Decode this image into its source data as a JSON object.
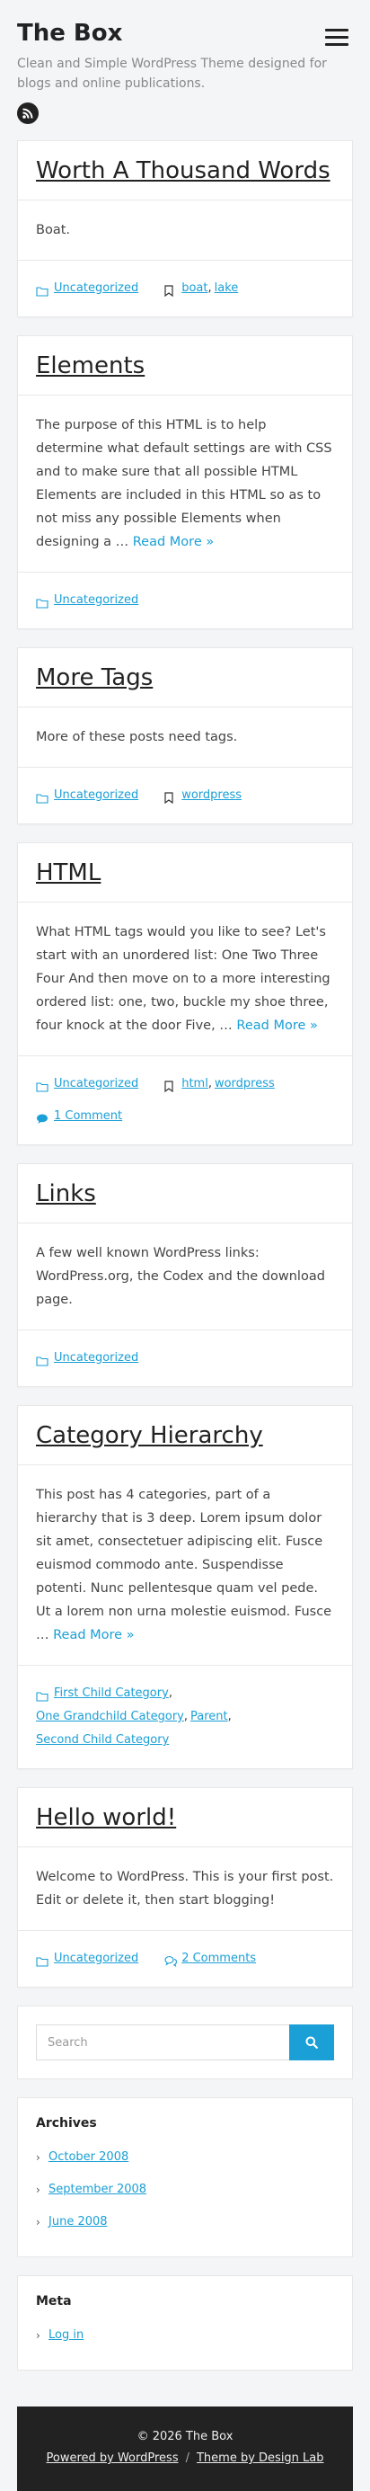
{
  "site": {
    "title": "The Box",
    "description": "Clean and Simple WordPress Theme designed for blogs and online publications."
  },
  "posts": [
    {
      "title": "Worth A Thousand Words",
      "excerpt": "Boat.",
      "more": "",
      "categories": [
        "Uncategorized"
      ],
      "tags": [
        "boat",
        "lake"
      ],
      "comments": ""
    },
    {
      "title": "Elements",
      "excerpt": "The purpose of this HTML is to help determine what default settings are with CSS and to make sure that all possible HTML Elements are included in this HTML so as to not miss any possible Elements when designing a …",
      "more": "Read More »",
      "categories": [
        "Uncategorized"
      ],
      "tags": [],
      "comments": ""
    },
    {
      "title": "More Tags",
      "excerpt": "More of these posts need tags.",
      "more": "",
      "categories": [
        "Uncategorized"
      ],
      "tags": [
        "wordpress"
      ],
      "comments": ""
    },
    {
      "title": "HTML",
      "excerpt": "What HTML tags would you like to see? Let's start with an unordered list: One Two Three Four And then move on to a more interesting ordered list: one, two, buckle my shoe three, four knock at the door Five, …",
      "more": "Read More »",
      "categories": [
        "Uncategorized"
      ],
      "tags": [
        "html",
        "wordpress"
      ],
      "comments": "1 Comment"
    },
    {
      "title": "Links",
      "excerpt": "A few well known WordPress links: WordPress.org, the Codex and the download page.",
      "more": "",
      "categories": [
        "Uncategorized"
      ],
      "tags": [],
      "comments": ""
    },
    {
      "title": "Category Hierarchy",
      "excerpt": "This post has 4 categories, part of a hierarchy that is 3 deep. Lorem ipsum dolor sit amet, consectetuer adipiscing elit. Fusce euismod commodo ante. Suspendisse potenti. Nunc pellentesque quam vel pede. Ut a lorem non urna molestie euismod. Fusce …",
      "more": "Read More »",
      "categories": [
        "First Child Category",
        "One Grandchild Category",
        "Parent",
        "Second Child Category"
      ],
      "tags": [],
      "comments": ""
    },
    {
      "title": "Hello world!",
      "excerpt": "Welcome to WordPress. This is your first post. Edit or delete it, then start blogging!",
      "more": "",
      "categories": [
        "Uncategorized"
      ],
      "tags": [],
      "comments": "2 Comments"
    }
  ],
  "search": {
    "placeholder": "Search"
  },
  "archives": {
    "title": "Archives",
    "items": [
      "October 2008",
      "September 2008",
      "June 2008"
    ]
  },
  "meta": {
    "title": "Meta",
    "items": [
      "Log in"
    ]
  },
  "footer": {
    "copyright": "© 2026 The Box",
    "powered": "Powered by WordPress",
    "theme": "Theme by Design Lab",
    "separator": "/"
  },
  "colors": {
    "accent": "#1a9fd6",
    "footer_bg": "#222222",
    "page_bg": "#f4f5f7"
  },
  "icons": {
    "menu": "hamburger-icon",
    "rss": "rss-icon",
    "category": "folder-icon",
    "tag": "bookmark-icon",
    "comment": "comment-icon",
    "search": "search-icon",
    "list_bullet": "chevron-right-icon"
  }
}
